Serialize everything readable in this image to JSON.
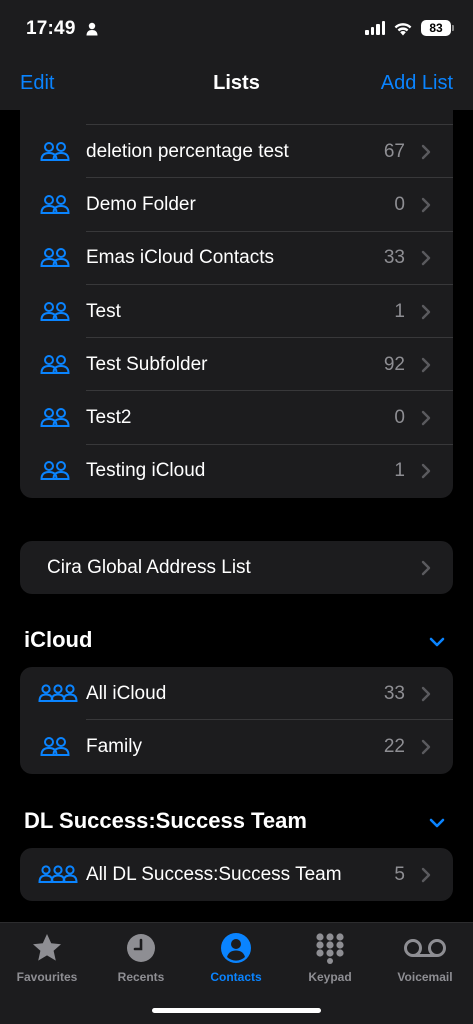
{
  "status_bar": {
    "time": "17:49",
    "battery": "83"
  },
  "nav": {
    "edit": "Edit",
    "title": "Lists",
    "add": "Add List"
  },
  "lists": [
    {
      "label": "deletion percentage test",
      "count": "67"
    },
    {
      "label": "Demo Folder",
      "count": "0"
    },
    {
      "label": "Emas iCloud Contacts",
      "count": "33"
    },
    {
      "label": "Test",
      "count": "1"
    },
    {
      "label": "Test Subfolder",
      "count": "92"
    },
    {
      "label": "Test2",
      "count": "0"
    },
    {
      "label": "Testing iCloud",
      "count": "1"
    }
  ],
  "global_address_list": {
    "label": "Cira Global Address List"
  },
  "icloud_section": {
    "title": "iCloud",
    "items": [
      {
        "label": "All iCloud",
        "count": "33"
      },
      {
        "label": "Family",
        "count": "22"
      }
    ]
  },
  "dl_section": {
    "title": "DL Success:Success Team",
    "items": [
      {
        "label": "All DL Success:Success Team",
        "count": "5"
      }
    ]
  },
  "tabbar": {
    "tabs": [
      {
        "label": "Favourites",
        "icon": "star-icon"
      },
      {
        "label": "Recents",
        "icon": "clock-icon"
      },
      {
        "label": "Contacts",
        "icon": "person-circle-icon",
        "active": true
      },
      {
        "label": "Keypad",
        "icon": "keypad-icon"
      },
      {
        "label": "Voicemail",
        "icon": "voicemail-icon"
      }
    ]
  },
  "colors": {
    "accent": "#0a84ff",
    "background": "#000000",
    "card": "#1c1c1e",
    "secondary_text": "#8e8e93"
  }
}
